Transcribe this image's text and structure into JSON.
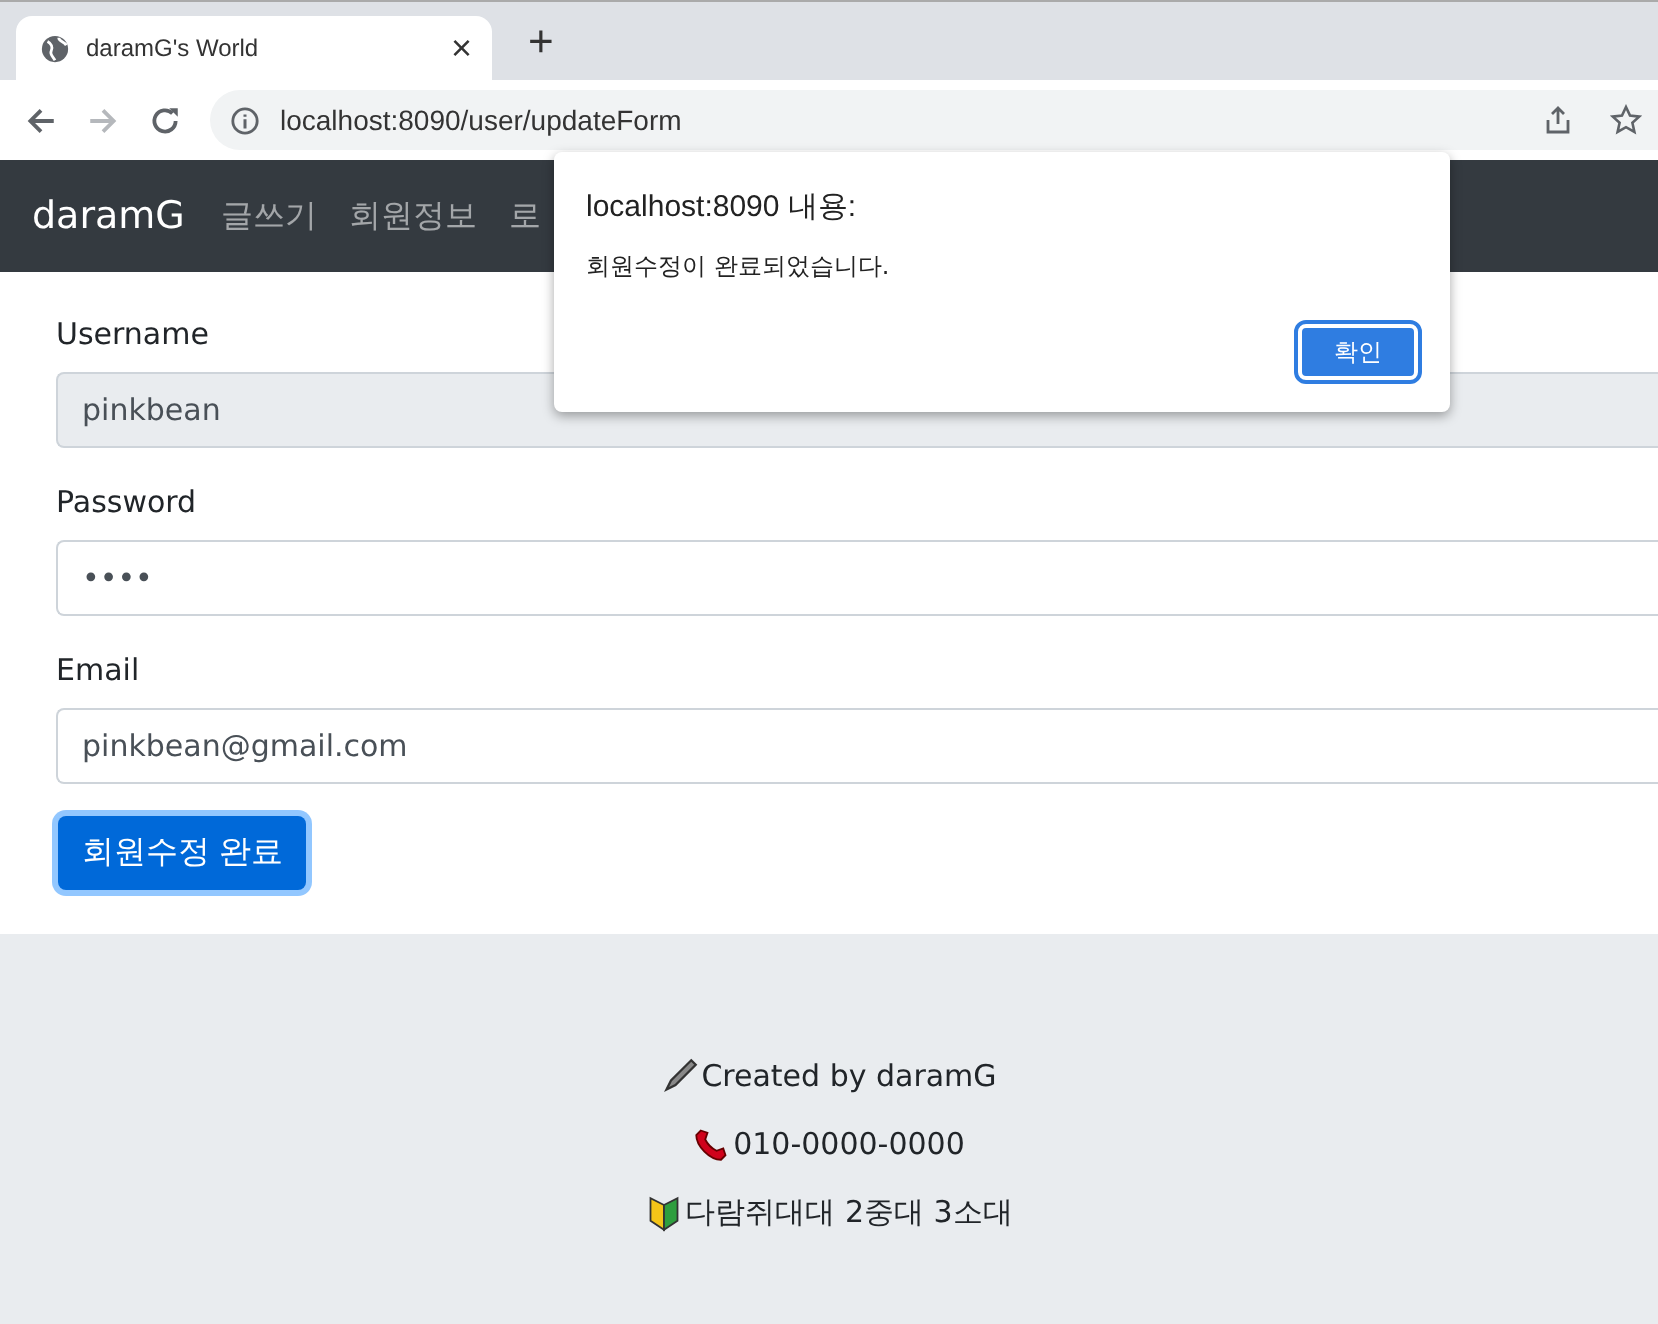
{
  "browser": {
    "tab_title": "daramG's World",
    "tab_close": "×",
    "new_tab": "+",
    "url": "localhost:8090/user/updateForm"
  },
  "navbar": {
    "brand": "daramG",
    "items": [
      "글쓰기",
      "회원정보",
      "로"
    ]
  },
  "form": {
    "fields": [
      {
        "label": "Username",
        "value": "pinkbean",
        "disabled": true
      },
      {
        "label": "Password",
        "value": "••••",
        "disabled": false
      },
      {
        "label": "Email",
        "value": "pinkbean@gmail.com",
        "disabled": false
      }
    ],
    "submit": "회원수정 완료"
  },
  "footer": {
    "lines": [
      {
        "kind": "pencil",
        "text": "Created by daramG"
      },
      {
        "kind": "phone",
        "text": "010-0000-0000"
      },
      {
        "kind": "leaf",
        "text": "다람쥐대대 2중대 3소대"
      }
    ]
  },
  "dialog": {
    "title": "localhost:8090 내용:",
    "message": "회원수정이 완료되었습니다.",
    "ok": "확인"
  }
}
